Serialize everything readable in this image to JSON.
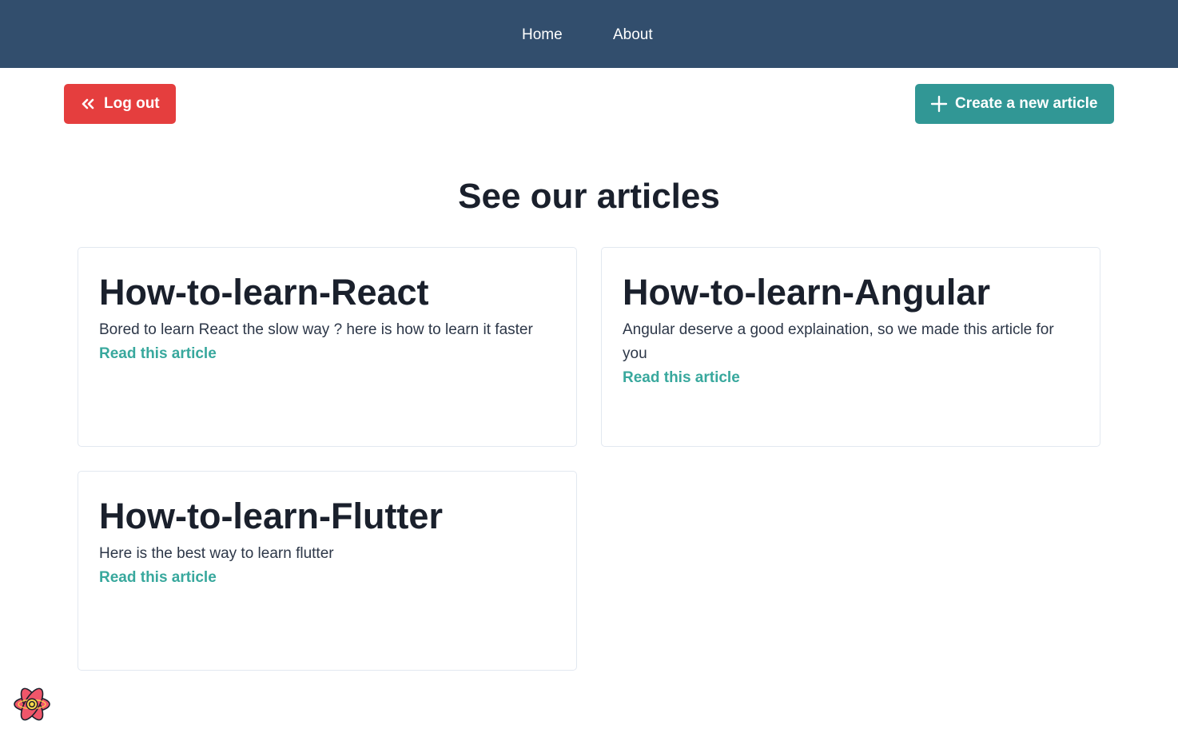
{
  "nav": {
    "home_label": "Home",
    "about_label": "About",
    "background": "#324e6d"
  },
  "actions": {
    "logout_label": "Log out",
    "logout_icon": "chevrons-left-icon",
    "logout_color": "#e53e3e",
    "create_label": "Create a new article",
    "create_icon": "plus-icon",
    "create_color": "#319795"
  },
  "page": {
    "title": "See our articles"
  },
  "articles": [
    {
      "title": "How-to-learn-React",
      "description": "Bored to learn React the slow way ? here is how to learn it faster",
      "link_label": "Read this article"
    },
    {
      "title": "How-to-learn-Angular",
      "description": "Angular deserve a good explaination, so we made this article for you",
      "link_label": "Read this article"
    },
    {
      "title": "How-to-learn-Flutter",
      "description": "Here is the best way to learn flutter",
      "link_label": "Read this article"
    }
  ],
  "link_color": "#38a89d",
  "devtools": {
    "icon": "react-query-devtools-icon"
  }
}
